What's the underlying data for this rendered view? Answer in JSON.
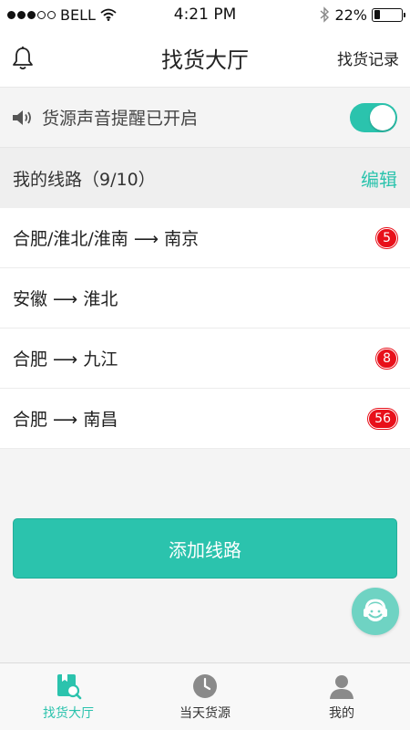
{
  "status_bar": {
    "carrier": "BELL",
    "time": "4:21 PM",
    "battery": "22%",
    "battery_level": 0.22
  },
  "nav": {
    "title": "找货大厅",
    "right_label": "找货记录",
    "left_icon": "bell-icon"
  },
  "sound_alert": {
    "text": "货源声音提醒已开启",
    "icon": "speaker-icon",
    "enabled": true
  },
  "routes": {
    "title": "我的线路（9/10）",
    "edit_label": "编辑",
    "items": [
      {
        "text": "合肥/淮北/淮南 ⟶ 南京",
        "badge": "5"
      },
      {
        "text": "安徽 ⟶ 淮北",
        "badge": ""
      },
      {
        "text": "合肥 ⟶ 九江",
        "badge": "8"
      },
      {
        "text": "合肥 ⟶ 南昌",
        "badge": "56"
      }
    ]
  },
  "add_route_label": "添加线路",
  "support_icon": "customer-service-icon",
  "tabbar": {
    "items": [
      {
        "label": "找货大厅",
        "icon": "find-goods-icon",
        "active": true
      },
      {
        "label": "当天货源",
        "icon": "clock-icon",
        "active": false
      },
      {
        "label": "我的",
        "icon": "user-icon",
        "active": false
      }
    ]
  },
  "colors": {
    "accent": "#2bc3ad",
    "badge": "#e8101a"
  }
}
